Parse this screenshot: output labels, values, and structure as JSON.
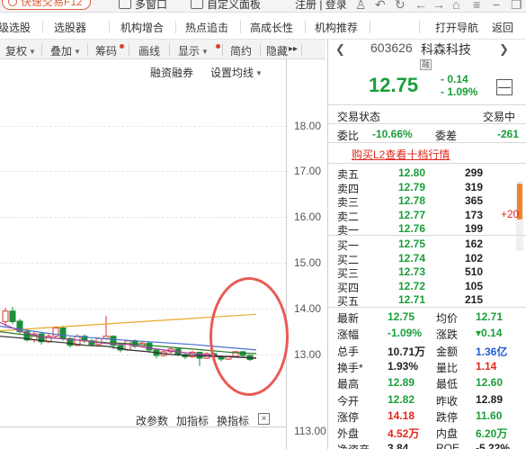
{
  "topbar": {
    "quick_trade": "快速交易F12",
    "multi_window": "多窗口",
    "custom_panel": "自定义面板",
    "login_register": "注册 | 登录"
  },
  "nav": {
    "items": [
      "级选股",
      "选股器",
      "机构增合",
      "热点追击",
      "高成长性",
      "机构推荐"
    ],
    "open_nav": "打开导航",
    "back": "返回"
  },
  "chart_toolbar": {
    "items": [
      "复权",
      "叠加",
      "筹码",
      "画线",
      "显示",
      "简约",
      "隐藏"
    ],
    "more": "▸▸"
  },
  "chart": {
    "margin_trading": "融资融券",
    "set_ma": "设置均线",
    "price_ticks": [
      "18.00",
      "17.00",
      "16.00",
      "15.00",
      "14.00",
      "13.00"
    ],
    "volume_tick": "113.00",
    "bottom_buttons": [
      "改参数",
      "加指标",
      "换指标"
    ],
    "close_glyph": "×",
    "candles": [
      {
        "o": 13.72,
        "c": 13.95,
        "h": 14.02,
        "l": 13.62
      },
      {
        "o": 13.95,
        "c": 13.72,
        "h": 14.04,
        "l": 13.66
      },
      {
        "o": 13.73,
        "c": 13.5,
        "h": 13.78,
        "l": 13.46
      },
      {
        "o": 13.5,
        "c": 13.32,
        "h": 13.56,
        "l": 13.28
      },
      {
        "o": 13.32,
        "c": 13.45,
        "h": 13.5,
        "l": 13.26
      },
      {
        "o": 13.45,
        "c": 13.28,
        "h": 13.5,
        "l": 13.22
      },
      {
        "o": 13.28,
        "c": 13.4,
        "h": 13.46,
        "l": 13.25
      },
      {
        "o": 13.4,
        "c": 13.58,
        "h": 13.62,
        "l": 13.36
      },
      {
        "o": 13.58,
        "c": 13.35,
        "h": 13.63,
        "l": 13.3
      },
      {
        "o": 13.35,
        "c": 13.2,
        "h": 13.38,
        "l": 13.15
      },
      {
        "o": 13.2,
        "c": 13.4,
        "h": 13.45,
        "l": 13.18
      },
      {
        "o": 13.4,
        "c": 13.3,
        "h": 13.44,
        "l": 13.25
      },
      {
        "o": 13.3,
        "c": 13.22,
        "h": 13.34,
        "l": 13.18
      },
      {
        "o": 13.22,
        "c": 13.35,
        "h": 13.38,
        "l": 13.2
      },
      {
        "o": 13.35,
        "c": 13.4,
        "h": 13.85,
        "l": 13.32
      },
      {
        "o": 13.4,
        "c": 13.2,
        "h": 13.42,
        "l": 13.12
      },
      {
        "o": 13.2,
        "c": 13.1,
        "h": 13.24,
        "l": 13.05
      },
      {
        "o": 13.1,
        "c": 13.3,
        "h": 13.32,
        "l": 13.08
      },
      {
        "o": 13.3,
        "c": 13.18,
        "h": 13.33,
        "l": 13.14
      },
      {
        "o": 13.18,
        "c": 13.25,
        "h": 13.28,
        "l": 13.15
      },
      {
        "o": 13.25,
        "c": 13.1,
        "h": 13.27,
        "l": 13.04
      },
      {
        "o": 13.1,
        "c": 12.98,
        "h": 13.12,
        "l": 12.92
      },
      {
        "o": 12.98,
        "c": 13.06,
        "h": 13.1,
        "l": 12.95
      },
      {
        "o": 13.06,
        "c": 13.12,
        "h": 13.15,
        "l": 13.02
      },
      {
        "o": 13.12,
        "c": 13.0,
        "h": 13.14,
        "l": 12.96
      },
      {
        "o": 13.0,
        "c": 12.95,
        "h": 13.02,
        "l": 12.9
      },
      {
        "o": 12.95,
        "c": 13.05,
        "h": 13.08,
        "l": 12.93
      },
      {
        "o": 13.05,
        "c": 12.92,
        "h": 13.06,
        "l": 12.75
      },
      {
        "o": 12.92,
        "c": 13.02,
        "h": 13.05,
        "l": 12.9
      },
      {
        "o": 13.02,
        "c": 12.95,
        "h": 13.04,
        "l": 12.92
      },
      {
        "o": 12.95,
        "c": 12.9,
        "h": 12.98,
        "l": 12.85
      },
      {
        "o": 12.9,
        "c": 12.96,
        "h": 12.98,
        "l": 12.88
      },
      {
        "o": 12.96,
        "c": 13.06,
        "h": 13.08,
        "l": 12.94
      },
      {
        "o": 13.06,
        "c": 12.98,
        "h": 13.08,
        "l": 12.93
      },
      {
        "o": 12.98,
        "c": 12.89,
        "h": 13.0,
        "l": 12.86
      }
    ],
    "ma_lines": [
      {
        "color": "#e8a82a",
        "values": [
          13.52,
          13.55,
          13.58,
          13.61,
          13.64,
          13.67,
          13.7,
          13.73,
          13.76,
          13.79,
          13.82,
          13.85,
          13.88
        ]
      },
      {
        "color": "#4a6fd1",
        "values": [
          13.62,
          13.55,
          13.48,
          13.42,
          13.38,
          13.34,
          13.31,
          13.28,
          13.25,
          13.22,
          13.18,
          13.14,
          13.1
        ]
      },
      {
        "color": "#2a7a2a",
        "values": [
          13.5,
          13.44,
          13.38,
          13.34,
          13.3,
          13.26,
          13.24,
          13.2,
          13.16,
          13.12,
          13.08,
          13.04,
          13.02
        ]
      },
      {
        "color": "#b03aa8",
        "values": [
          13.7,
          13.5,
          13.38,
          13.34,
          13.3,
          13.24,
          13.22,
          13.14,
          13.08,
          13.02,
          12.98,
          12.94,
          12.93
        ]
      },
      {
        "color": "#2a2a2a",
        "values": [
          13.4,
          13.36,
          13.3,
          13.26,
          13.2,
          13.18,
          13.1,
          13.06,
          13.0,
          12.98,
          12.96,
          12.95,
          12.92
        ]
      }
    ]
  },
  "quote": {
    "code": "603626",
    "name": "科森科技",
    "rong": "融",
    "price": "12.75",
    "change": "- 0.14",
    "change_pct": "- 1.09%",
    "minus_glyph": "—",
    "trade_status_label": "交易状态",
    "trade_status_value": "交易中",
    "wei_bi_label": "委比",
    "wei_bi_value": "-10.66%",
    "wei_cha_label": "委差",
    "wei_cha_value": "-261",
    "buy_l2": "购买L2查看十档行情",
    "extra_red": "+20",
    "sell_levels": [
      {
        "label": "卖五",
        "price": "12.80",
        "vol": "299"
      },
      {
        "label": "卖四",
        "price": "12.79",
        "vol": "319"
      },
      {
        "label": "卖三",
        "price": "12.78",
        "vol": "365"
      },
      {
        "label": "卖二",
        "price": "12.77",
        "vol": "173"
      },
      {
        "label": "卖一",
        "price": "12.76",
        "vol": "199"
      }
    ],
    "buy_levels": [
      {
        "label": "买一",
        "price": "12.75",
        "vol": "162"
      },
      {
        "label": "买二",
        "price": "12.74",
        "vol": "102"
      },
      {
        "label": "买三",
        "price": "12.73",
        "vol": "510"
      },
      {
        "label": "买四",
        "price": "12.72",
        "vol": "105"
      },
      {
        "label": "买五",
        "price": "12.71",
        "vol": "215"
      }
    ],
    "stats": [
      {
        "l1": "最新",
        "v1": "12.75",
        "c1": "green",
        "l2": "均价",
        "v2": "12.71",
        "c2": "green"
      },
      {
        "l1": "涨幅",
        "v1": "-1.09%",
        "c1": "green",
        "l2": "涨跌",
        "v2": "▾0.14",
        "c2": "green"
      },
      {
        "l1": "总手",
        "v1": "10.71万",
        "c1": "dark",
        "l2": "金额",
        "v2": "1.36亿",
        "c2": "blue"
      },
      {
        "l1": "换手*",
        "v1": "1.93%",
        "c1": "dark",
        "l2": "量比",
        "v2": "1.14",
        "c2": "red"
      },
      {
        "l1": "最高",
        "v1": "12.89",
        "c1": "green",
        "l2": "最低",
        "v2": "12.60",
        "c2": "green"
      },
      {
        "l1": "今开",
        "v1": "12.82",
        "c1": "green",
        "l2": "昨收",
        "v2": "12.89",
        "c2": "dark"
      },
      {
        "l1": "涨停",
        "v1": "14.18",
        "c1": "red",
        "l2": "跌停",
        "v2": "11.60",
        "c2": "green"
      },
      {
        "l1": "外盘",
        "v1": "4.52万",
        "c1": "red",
        "l2": "内盘",
        "v2": "6.20万",
        "c2": "green"
      },
      {
        "l1": "净资产",
        "v1": "3.84",
        "c1": "dark",
        "l2": "ROE",
        "v2": "-5.22%",
        "c2": "dark"
      }
    ]
  }
}
